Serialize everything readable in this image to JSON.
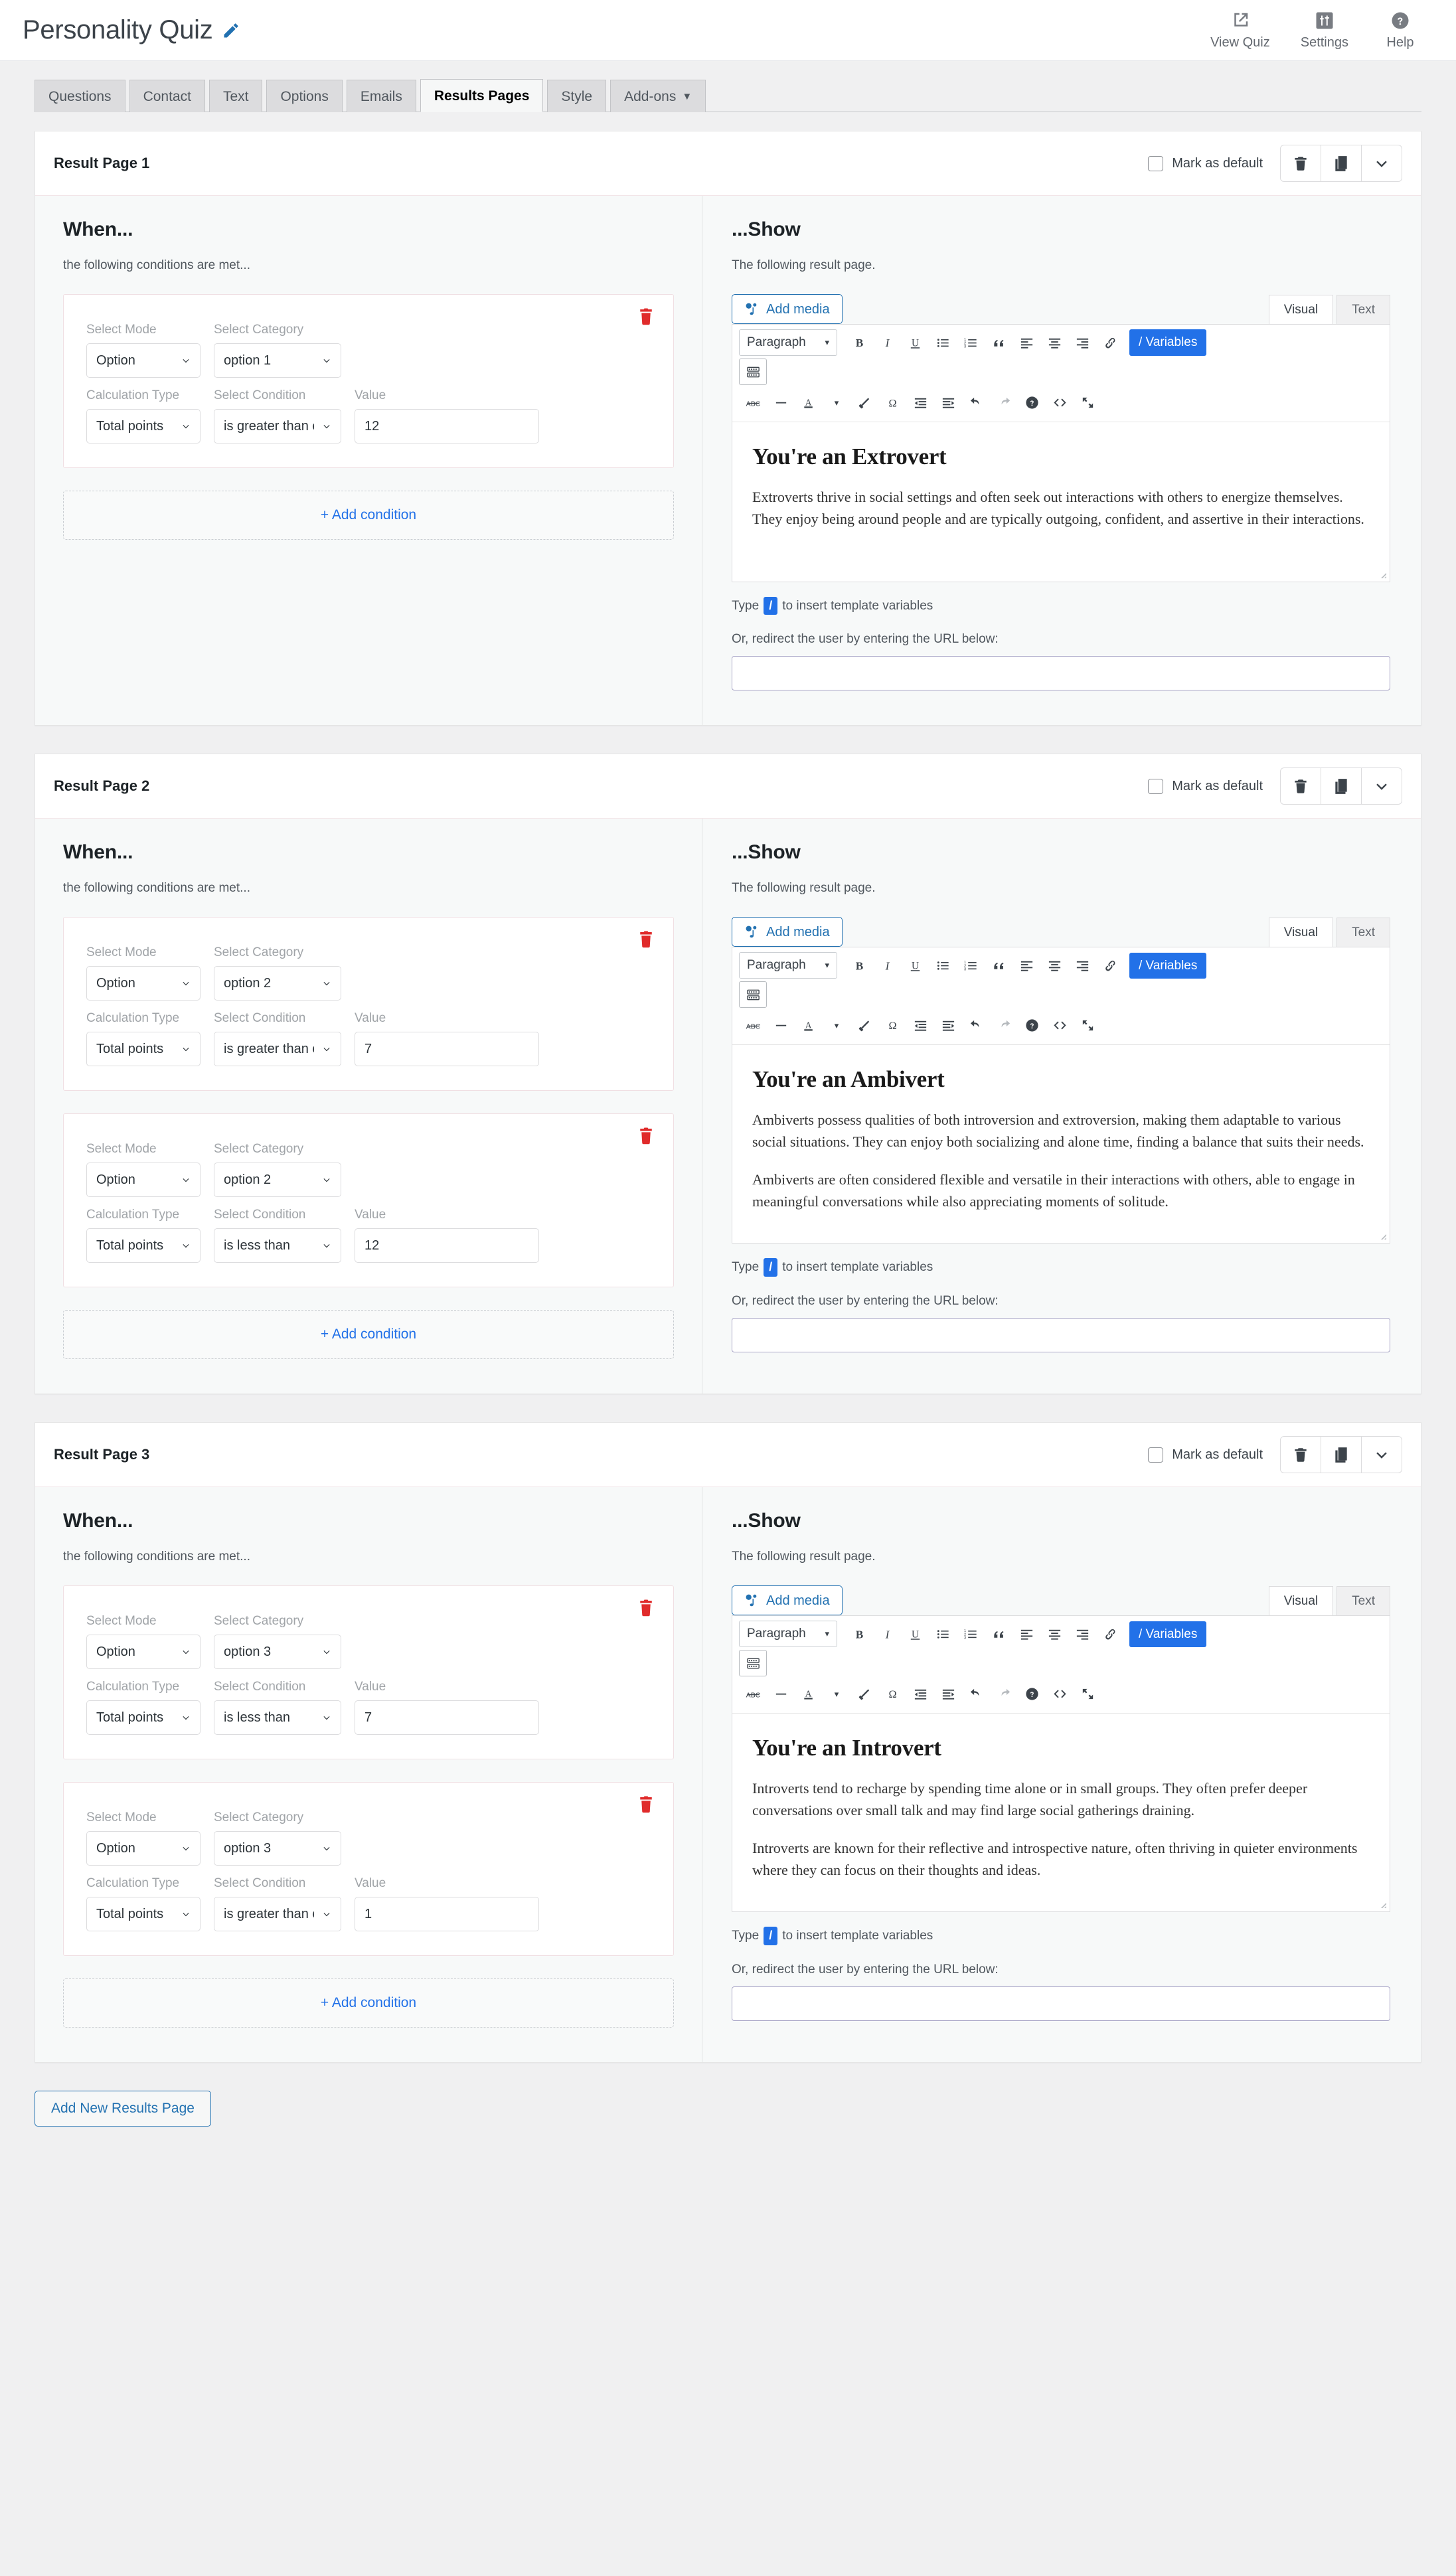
{
  "header": {
    "quiz_title": "Personality Quiz",
    "edit_icon": "pencil-icon",
    "nav": [
      {
        "label": "View Quiz",
        "icon": "external-link-icon"
      },
      {
        "label": "Settings",
        "icon": "sliders-icon"
      },
      {
        "label": "Help",
        "icon": "question-circle-icon"
      }
    ]
  },
  "tabs": [
    {
      "label": "Questions",
      "active": false
    },
    {
      "label": "Contact",
      "active": false
    },
    {
      "label": "Text",
      "active": false
    },
    {
      "label": "Options",
      "active": false
    },
    {
      "label": "Emails",
      "active": false
    },
    {
      "label": "Results Pages",
      "active": true
    },
    {
      "label": "Style",
      "active": false
    },
    {
      "label": "Add-ons",
      "active": false,
      "caret": "▼"
    }
  ],
  "common": {
    "mark_as_default": "Mark as default",
    "when_heading": "When...",
    "when_sub": "the following conditions are met...",
    "show_heading": "...Show",
    "show_sub": "The following result page.",
    "add_condition": "+ Add condition",
    "add_media": "Add media",
    "visual_tab": "Visual",
    "text_tab": "Text",
    "format_select": "Paragraph",
    "variables_btn": "/ Variables",
    "hint_prefix": "Type",
    "hint_slash": "/",
    "hint_suffix": "to insert template variables",
    "redirect_label": "Or, redirect the user by entering the URL below:",
    "url_value": "",
    "url_placeholder": "",
    "labels": {
      "select_mode": "Select Mode",
      "select_category": "Select Category",
      "calculation_type": "Calculation Type",
      "select_condition": "Select Condition",
      "value": "Value"
    },
    "toolbar_icons": [
      "bold-icon",
      "italic-icon",
      "underline-icon",
      "bulleted-list-icon",
      "numbered-list-icon",
      "blockquote-icon",
      "align-left-icon",
      "align-center-icon",
      "align-right-icon",
      "link-icon"
    ],
    "toolbar_row3_icons": [
      "strikethrough-icon",
      "horizontal-rule-icon",
      "text-color-icon",
      "clear-formatting-icon",
      "special-character-icon",
      "outdent-icon",
      "indent-icon",
      "undo-icon",
      "redo-icon",
      "keyboard-help-icon",
      "source-code-icon",
      "fullscreen-icon"
    ],
    "toolbar_row2_icons": [
      "toolbar-toggle-icon"
    ],
    "panel_actions": [
      "trash-icon",
      "duplicate-icon",
      "chevron-down-icon"
    ]
  },
  "colors": {
    "accent_blue": "#2271e8",
    "link_blue": "#2271b1",
    "danger_red": "#e02b2b",
    "page_bg": "#f0f0f1",
    "panel_bg": "#f7f9f9"
  },
  "result_pages": [
    {
      "title": "Result Page 1",
      "mark_default_checked": false,
      "conditions": [
        {
          "mode": "Option",
          "category": "option 1",
          "calculation": "Total points",
          "condition": "is greater than or eq",
          "value": "12"
        }
      ],
      "content": {
        "heading": "You're an Extrovert",
        "paragraphs": [
          "Extroverts thrive in social settings and often seek out interactions with others to energize themselves. They enjoy being around people and are typically outgoing, confident, and assertive in their interactions."
        ]
      }
    },
    {
      "title": "Result Page 2",
      "mark_default_checked": false,
      "conditions": [
        {
          "mode": "Option",
          "category": "option 2",
          "calculation": "Total points",
          "condition": "is greater than or eq",
          "value": "7"
        },
        {
          "mode": "Option",
          "category": "option 2",
          "calculation": "Total points",
          "condition": "is less than",
          "value": "12"
        }
      ],
      "content": {
        "heading": "You're an Ambivert",
        "paragraphs": [
          "Ambiverts possess qualities of both introversion and extroversion, making them adaptable to various social situations. They can enjoy both socializing and alone time, finding a balance that suits their needs.",
          "Ambiverts are often considered flexible and versatile in their interactions with others, able to engage in meaningful conversations while also appreciating moments of solitude."
        ]
      }
    },
    {
      "title": "Result Page 3",
      "mark_default_checked": false,
      "conditions": [
        {
          "mode": "Option",
          "category": "option 3",
          "calculation": "Total points",
          "condition": "is less than",
          "value": "7"
        },
        {
          "mode": "Option",
          "category": "option 3",
          "calculation": "Total points",
          "condition": "is greater than or eq",
          "value": "1"
        }
      ],
      "content": {
        "heading": "You're an Introvert",
        "paragraphs": [
          "Introverts tend to recharge by spending time alone or in small groups. They often prefer deeper conversations over small talk and may find large social gatherings draining.",
          "Introverts are known for their reflective and introspective nature, often thriving in quieter environments where they can focus on their thoughts and ideas."
        ]
      }
    }
  ],
  "footer": {
    "add_new_results_page": "Add New Results Page"
  }
}
